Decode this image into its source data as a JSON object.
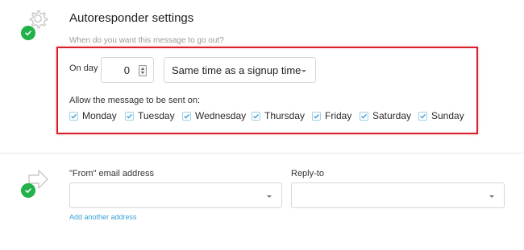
{
  "section_schedule": {
    "title": "Autoresponder settings",
    "subtitle": "When do you want this message to go out?",
    "on_day_label": "On day",
    "day_value": "0",
    "time_option": "Same time as a signup time",
    "allow_label": "Allow the message to be sent on:",
    "days": [
      {
        "label": "Monday",
        "checked": true
      },
      {
        "label": "Tuesday",
        "checked": true
      },
      {
        "label": "Wednesday",
        "checked": true
      },
      {
        "label": "Thursday",
        "checked": true
      },
      {
        "label": "Friday",
        "checked": true
      },
      {
        "label": "Saturday",
        "checked": true
      },
      {
        "label": "Sunday",
        "checked": true
      }
    ],
    "icon": "gear-icon",
    "status_icon": "check-icon"
  },
  "section_sender": {
    "from_label": "\"From\" email address",
    "from_value": "",
    "reply_label": "Reply-to",
    "reply_value": "",
    "add_link": "Add another address",
    "icon": "arrow-right-icon",
    "status_icon": "check-icon"
  },
  "colors": {
    "accent_green": "#21b24a",
    "highlight_red": "#d81f2a",
    "link_blue": "#3aa1d6",
    "checkbox_blue": "#3aa1d6"
  }
}
